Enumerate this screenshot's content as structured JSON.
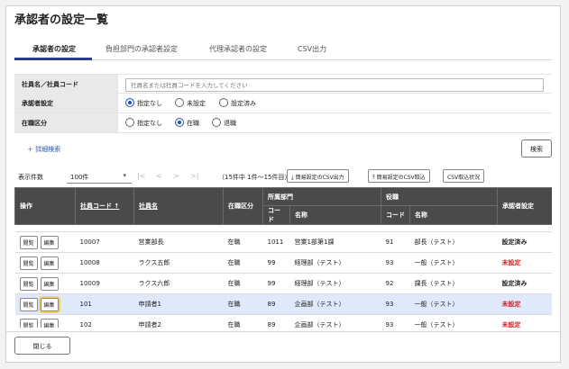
{
  "page_title": "承認者の設定一覧",
  "tabs": [
    "承認者の設定",
    "負担部門の承認者設定",
    "代理承認者の設定",
    "CSV出力"
  ],
  "form": {
    "employee": {
      "label": "社員名／社員コード",
      "placeholder": "社員名または社員コードを入力してください"
    },
    "approver": {
      "label": "承認者設定",
      "options": [
        "指定なし",
        "未設定",
        "設定済み"
      ],
      "selected": "指定なし"
    },
    "status": {
      "label": "在職区分",
      "options": [
        "指定なし",
        "在職",
        "退職"
      ],
      "selected": "在職"
    },
    "advanced_search": "＋ 詳細検索",
    "search_button": "検索"
  },
  "pager": {
    "count_label": "表示件数",
    "page_size": "100件",
    "nav": [
      "|<",
      "<",
      ">",
      ">|"
    ],
    "range_text": "（15件中 1件～15件目）",
    "buttons": [
      "簡易設定のCSV出力",
      "簡易設定のCSV取込",
      "CSV取込状況"
    ]
  },
  "table": {
    "headers": {
      "ops": "操作",
      "emp_code": "社員コード ↑",
      "emp_name": "社員名",
      "status": "在職区分",
      "dept": "所属部門",
      "dept_code": "コード",
      "dept_name": "名称",
      "position": "役職",
      "pos_code": "コード",
      "pos_name": "名称",
      "approver": "承認者設定"
    },
    "row_buttons": [
      "閲覧",
      "編集"
    ],
    "rows": [
      {
        "code": "10007",
        "name": "営業部長",
        "status": "在職",
        "dcode": "1011",
        "dname": "営業1部第1課",
        "pcode": "91",
        "pname": "部長（テスト）",
        "approver": "設定済み",
        "ok": true
      },
      {
        "code": "10008",
        "name": "ラクス五郎",
        "status": "在職",
        "dcode": "99",
        "dname": "経理部（テスト）",
        "pcode": "93",
        "pname": "一般（テスト）",
        "approver": "未設定",
        "ok": false
      },
      {
        "code": "10009",
        "name": "ラクス六郎",
        "status": "在職",
        "dcode": "99",
        "dname": "経理部（テスト）",
        "pcode": "92",
        "pname": "課長（テスト）",
        "approver": "設定済み",
        "ok": true
      },
      {
        "code": "101",
        "name": "申請者1",
        "status": "在職",
        "dcode": "89",
        "dname": "企画部（テスト）",
        "pcode": "93",
        "pname": "一般（テスト）",
        "approver": "未設定",
        "ok": false,
        "selected": true
      },
      {
        "code": "102",
        "name": "申請者2",
        "status": "在職",
        "dcode": "89",
        "dname": "企画部（テスト）",
        "pcode": "93",
        "pname": "一般（テスト）",
        "approver": "未設定",
        "ok": false
      }
    ]
  },
  "close_button": "閉じる"
}
